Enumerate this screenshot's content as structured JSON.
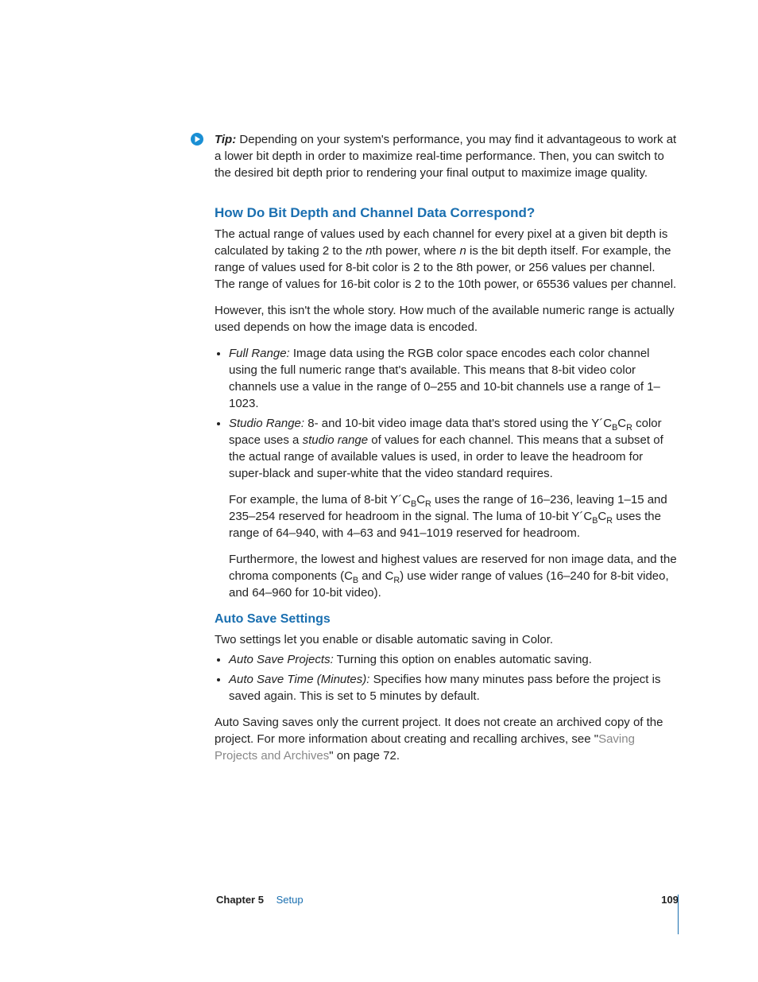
{
  "tip": {
    "label": "Tip:",
    "body": "Depending on your system's performance, you may find it advantageous to work at a lower bit depth in order to maximize real-time performance. Then, you can switch to the desired bit depth prior to rendering your final output to maximize image quality."
  },
  "section1": {
    "heading": "How Do Bit Depth and Channel Data Correspond?",
    "p1_a": "The actual range of values used by each channel for every pixel at a given bit depth is calculated by taking 2 to the ",
    "p1_n1": "n",
    "p1_b": "th power, where ",
    "p1_n2": "n",
    "p1_c": " is the bit depth itself. For example, the range of values used for 8-bit color is 2 to the 8th power, or 256 values per channel. The range of values for 16-bit color is 2 to the 10th power, or 65536 values per channel.",
    "p2": "However, this isn't the whole story. How much of the available numeric range is actually used depends on how the image data is encoded.",
    "bullets": {
      "full": {
        "term": "Full Range:",
        "text": "Image data using the RGB color space encodes each color channel using the full numeric range that's available. This means that 8-bit video color channels use a value in the range of 0–255 and 10-bit channels use a range of 1–1023."
      },
      "studio": {
        "term": "Studio Range:",
        "t1": "8- and 10-bit video image data that's stored using the Y´C",
        "sB1": "B",
        "t2": "C",
        "sR1": "R",
        "t3": " color space uses a ",
        "sr": "studio range",
        "t4": " of values for each channel. This means that a subset of the actual range of available values is used, in order to leave the headroom for super-black and super-white that the video standard requires."
      }
    },
    "example": {
      "a": "For example, the luma of 8-bit Y´C",
      "sB1": "B",
      "b": "C",
      "sR1": "R",
      "c": " uses the range of 16–236, leaving 1–15 and 235–254 reserved for headroom in the signal. The luma of 10-bit Y´C",
      "sB2": "B",
      "d": "C",
      "sR2": "R",
      "e": " uses the range of 64–940, with 4–63 and 941–1019 reserved for headroom."
    },
    "further": {
      "a": "Furthermore, the lowest and highest values are reserved for non image data, and the chroma components (C",
      "sB": "B",
      "b": " and C",
      "sR": "R",
      "c": ") use wider range of values (16–240 for 8-bit video, and 64–960 for 10-bit video)."
    }
  },
  "section2": {
    "heading": "Auto Save Settings",
    "intro": "Two settings let you enable or disable automatic saving in Color.",
    "bullets": {
      "b1": {
        "term": "Auto Save Projects:",
        "text": "Turning this option on enables automatic saving."
      },
      "b2": {
        "term": "Auto Save Time (Minutes):",
        "text": "Specifies how many minutes pass before the project is saved again. This is set to 5 minutes by default."
      }
    },
    "closing": {
      "a": "Auto Saving saves only the current project. It does not create an archived copy of the project. For more information about creating and recalling archives, see \"",
      "link": "Saving Projects and Archives",
      "b": "\" on page 72."
    }
  },
  "footer": {
    "chapter": "Chapter 5",
    "title": "Setup",
    "page": "109"
  }
}
